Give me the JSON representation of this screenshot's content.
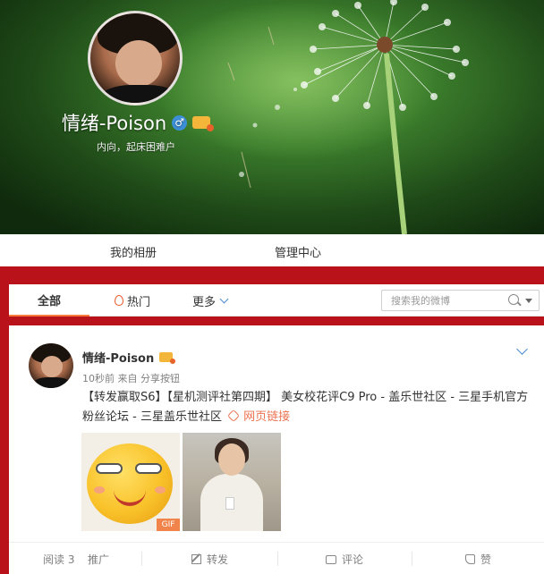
{
  "profile": {
    "name": "情绪-Poison",
    "gender_symbol": "♂",
    "bio": "内向，起床困难户",
    "nav": [
      "我的相册",
      "管理中心"
    ]
  },
  "tabs": {
    "all": "全部",
    "hot": "热门",
    "more": "更多",
    "search_placeholder": "搜索我的微博"
  },
  "post": {
    "author": "情绪-Poison",
    "meta": "10秒前 来自 分享按钮",
    "text_line": "【转发赢取S6】【星机测评社第四期】 美女校花评C9 Pro - 盖乐世社区 - 三星手机官方粉丝论坛 - 三星盖乐世社区",
    "link_label": "网页链接",
    "gif_badge": "GIF"
  },
  "actions": {
    "reads": "阅读 3",
    "promote": "推广",
    "repost": "转发",
    "comment": "评论",
    "like": "赞"
  },
  "colors": {
    "brand_red": "#b9121b",
    "accent_orange": "#f77c3d",
    "link_orange": "#eb7350"
  }
}
